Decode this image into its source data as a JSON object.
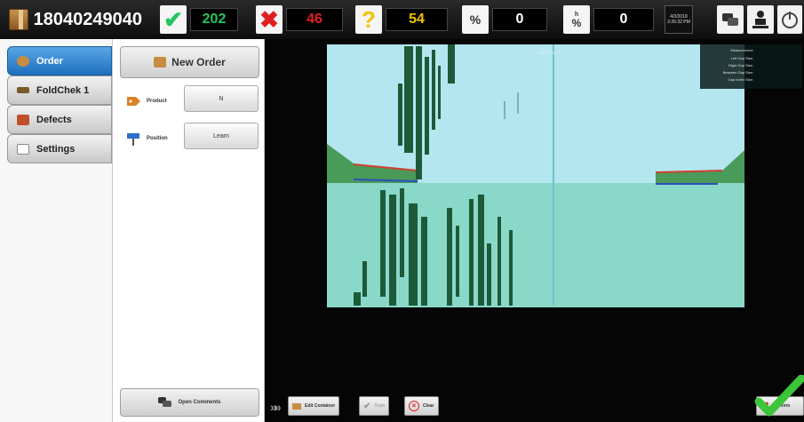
{
  "topbar": {
    "order_id": "18040249040",
    "good_count": "202",
    "bad_count": "46",
    "unknown_count": "54",
    "rate_per_hour": "0",
    "rate_per_min": "0",
    "rate_hr_symbol": "%",
    "rate_min_symbol": "%",
    "rate_min_unit": "h",
    "date": "4/3/2018",
    "time": "2:26:32 PM",
    "colors": {
      "good": "#22c55e",
      "bad": "#e02020",
      "unknown": "#f2c200"
    }
  },
  "tabs": [
    {
      "label": "Order",
      "active": true,
      "icon": "box-icon"
    },
    {
      "label": "FoldChek 1",
      "active": false,
      "icon": "camera-icon"
    },
    {
      "label": "Defects",
      "active": false,
      "icon": "defect-icon"
    },
    {
      "label": "Settings",
      "active": false,
      "icon": "settings-icon"
    }
  ],
  "subpanel": {
    "new_order_label": "New Order",
    "product_label": "Product",
    "product_value": "N",
    "position_label": "Position",
    "position_value": "Learn",
    "open_comments_label": "Open Comments"
  },
  "camera": {
    "title": "FoldChek 1",
    "overlay_lines": [
      "Measurement:",
      "Left Gap Size:",
      "Right Gap Size:",
      "Between Gap Size:",
      "Gap Index Size:"
    ],
    "toolbar": {
      "edit_label": "Edit Container",
      "train_label": "Train",
      "clear_label": "Clear",
      "confirm_label": "Confirm"
    }
  }
}
